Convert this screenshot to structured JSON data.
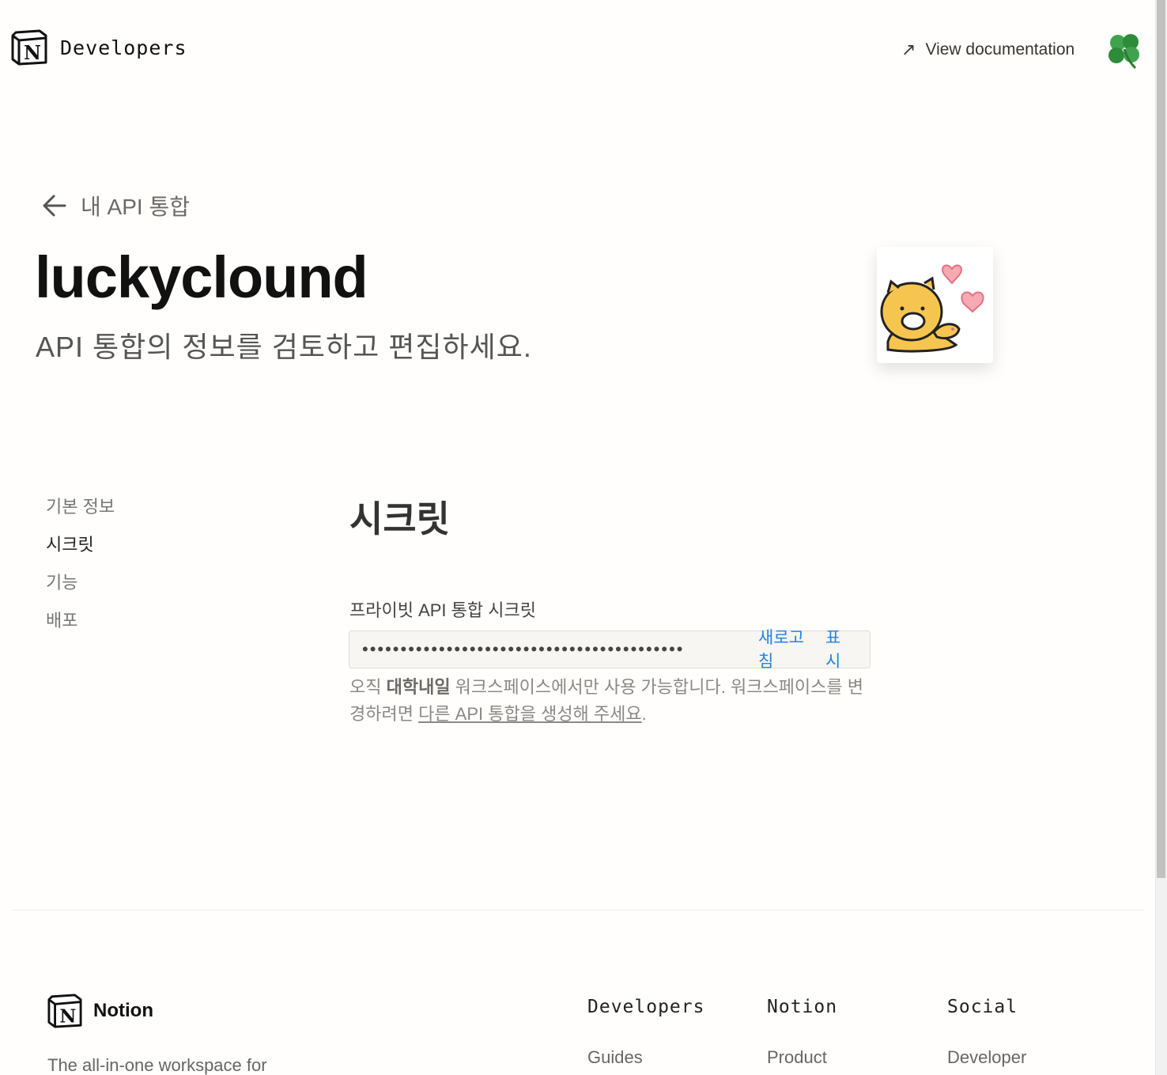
{
  "header": {
    "brand": "Developers",
    "view_documentation": "View documentation"
  },
  "hero": {
    "back_label": "내 API 통합",
    "title": "luckyclound",
    "subtitle": "API 통합의 정보를 검토하고 편집하세요."
  },
  "sidenav": {
    "items": [
      "기본 정보",
      "시크릿",
      "기능",
      "배포"
    ],
    "active_index": 1
  },
  "secret_section": {
    "title": "시크릿",
    "field_label": "프라이빗 API 통합 시크릿",
    "masked_value": "••••••••••••••••••••••••••••••••••••••••••",
    "refresh_label": "새로고침",
    "show_label": "표시",
    "note_prefix": "오직 ",
    "note_workspace": "대학내일",
    "note_middle": " 워크스페이스에서만 사용 가능합니다. 워크스페이스를 변경하려면 ",
    "note_link": "다른 API 통합을 생성해 주세요",
    "note_suffix": "."
  },
  "footer": {
    "logo_text": "Notion",
    "tagline": "The all-in-one workspace for",
    "columns": [
      {
        "heading": "Developers",
        "first_link": "Guides"
      },
      {
        "heading": "Notion",
        "first_link": "Product"
      },
      {
        "heading": "Social",
        "first_link": "Developer"
      }
    ]
  },
  "colors": {
    "accent": "#2383e2",
    "background": "#fffefc",
    "text": "#37352f"
  },
  "icons": {
    "avatar": "four-leaf-clover-icon",
    "integration": "yellow-cat-with-hearts-icon"
  }
}
